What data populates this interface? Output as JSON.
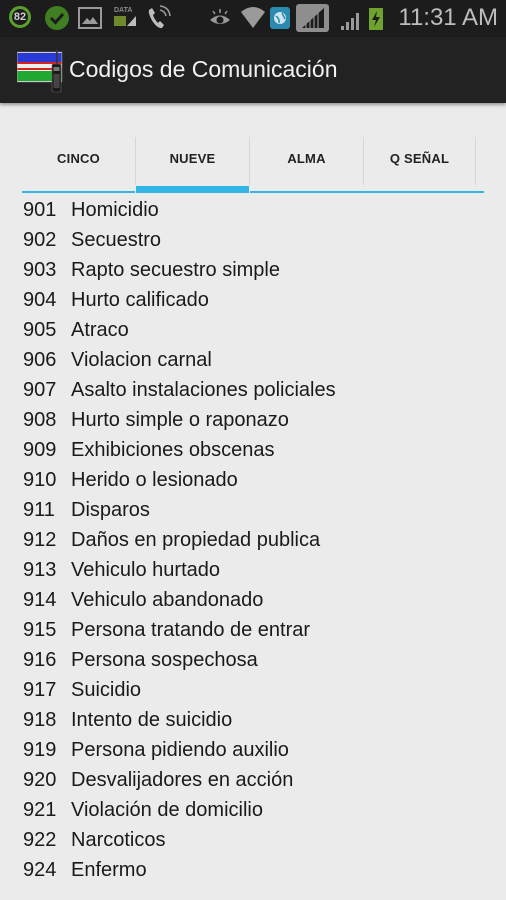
{
  "status_bar": {
    "battery_percent_badge": "82",
    "data_label": "DATA",
    "time": "11:31 AM",
    "icons": [
      "battery-level-icon",
      "check-icon",
      "image-icon",
      "data-icon",
      "phone-icon",
      "eye-icon",
      "wifi-icon",
      "globe-icon",
      "signal-icon",
      "signal-icon",
      "charging-battery-icon"
    ]
  },
  "action_bar": {
    "title": "Codigos de Comunicación",
    "app_icon": "flag-radio-icon"
  },
  "colors": {
    "accent": "#33b5e5",
    "action_bar_bg": "#222222",
    "status_bar_bg": "#1c1c1c",
    "content_bg": "#ebebeb"
  },
  "tabs": [
    {
      "label": "CINCO",
      "active": false
    },
    {
      "label": "NUEVE",
      "active": true
    },
    {
      "label": "ALMA",
      "active": false
    },
    {
      "label": "Q SEÑAL",
      "active": false
    }
  ],
  "codes": [
    {
      "code": "901",
      "desc": "Homicidio"
    },
    {
      "code": "902",
      "desc": "Secuestro"
    },
    {
      "code": "903",
      "desc": "Rapto secuestro simple"
    },
    {
      "code": "904",
      "desc": "Hurto calificado"
    },
    {
      "code": "905",
      "desc": "Atraco"
    },
    {
      "code": "906",
      "desc": "Violacion carnal"
    },
    {
      "code": "907",
      "desc": "Asalto instalaciones policiales"
    },
    {
      "code": "908",
      "desc": "Hurto simple o raponazo"
    },
    {
      "code": "909",
      "desc": "Exhibiciones obscenas"
    },
    {
      "code": "910",
      "desc": "Herido o lesionado"
    },
    {
      "code": "911",
      "desc": "Disparos"
    },
    {
      "code": "912",
      "desc": "Daños en propiedad publica"
    },
    {
      "code": "913",
      "desc": "Vehiculo hurtado"
    },
    {
      "code": "914",
      "desc": "Vehiculo abandonado"
    },
    {
      "code": "915",
      "desc": "Persona tratando de entrar"
    },
    {
      "code": "916",
      "desc": "Persona sospechosa"
    },
    {
      "code": "917",
      "desc": "Suicidio"
    },
    {
      "code": "918",
      "desc": "Intento de suicidio"
    },
    {
      "code": "919",
      "desc": "Persona pidiendo auxilio"
    },
    {
      "code": "920",
      "desc": "Desvalijadores en acción"
    },
    {
      "code": "921",
      "desc": "Violación de domicilio"
    },
    {
      "code": "922",
      "desc": "Narcoticos"
    },
    {
      "code": "924",
      "desc": "Enfermo"
    }
  ]
}
